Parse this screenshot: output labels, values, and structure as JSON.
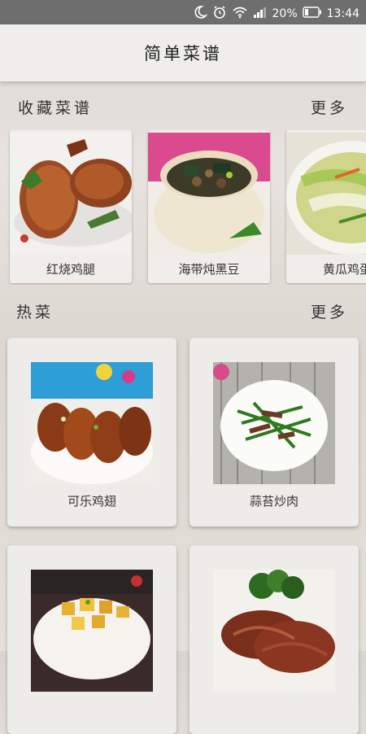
{
  "status_bar": {
    "battery": "20%",
    "time": "13:44",
    "icons": [
      "moon-icon",
      "alarm-icon",
      "wifi-icon",
      "signal-icon",
      "battery-icon"
    ]
  },
  "app": {
    "title": "简单菜谱"
  },
  "favorites": {
    "title": "收藏菜谱",
    "more": "更多",
    "items": [
      {
        "label": "红烧鸡腿"
      },
      {
        "label": "海带炖黑豆"
      },
      {
        "label": "黄瓜鸡蛋"
      }
    ]
  },
  "hot": {
    "title": "热菜",
    "more": "更多",
    "items": [
      {
        "label": "可乐鸡翅"
      },
      {
        "label": "蒜苔炒肉"
      },
      {
        "label": ""
      },
      {
        "label": ""
      }
    ]
  },
  "colors": {
    "status_bar": "#6e6e6e",
    "app_bar": "#efeeec",
    "card": "#eeece8"
  }
}
